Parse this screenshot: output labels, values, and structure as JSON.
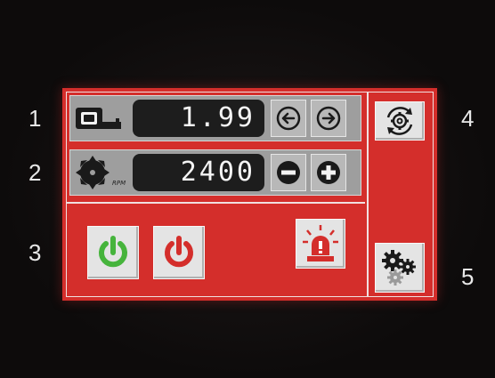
{
  "callouts": {
    "one": "1",
    "two": "2",
    "three": "3",
    "four": "4",
    "five": "5"
  },
  "length_row": {
    "value": "1.99"
  },
  "speed_row": {
    "value": "2400",
    "unit": "RPM"
  },
  "colors": {
    "panel": "#d42e2b",
    "display_bg": "#1d1d1d",
    "start_green": "#46b43c",
    "stop_red": "#d42e2b"
  },
  "icons": {
    "length": "tape-measure-icon",
    "speed": "saw-blade-icon",
    "decrease_length": "arrow-left-icon",
    "increase_length": "arrow-right-icon",
    "decrease_speed": "minus-icon",
    "increase_speed": "plus-icon",
    "start": "power-on-icon",
    "stop": "power-off-icon",
    "alarm": "alarm-light-icon",
    "sync": "gear-sync-icon",
    "settings": "gears-icon"
  }
}
